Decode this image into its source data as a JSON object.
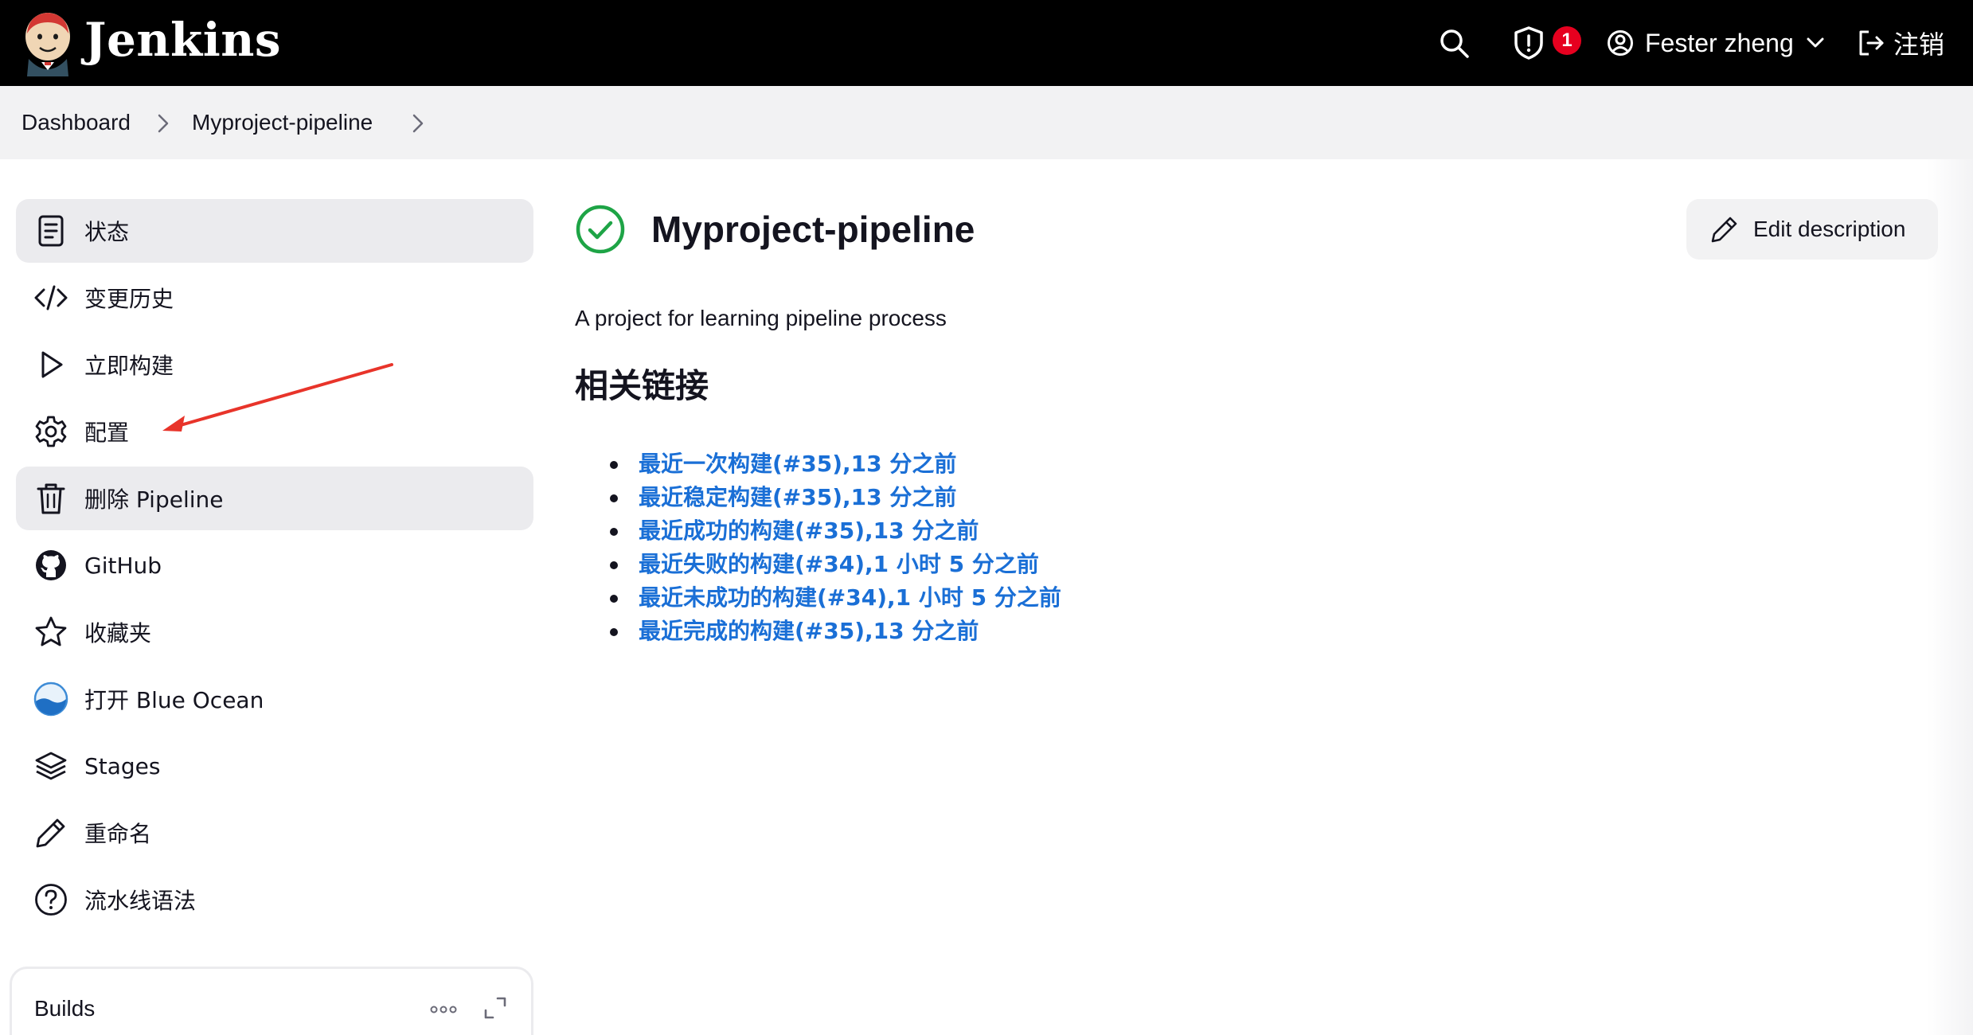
{
  "header": {
    "brand": "Jenkins",
    "security_count": "1",
    "user_name": "Fester zheng",
    "logout_label": "注销",
    "icons": [
      "jenkins-logo",
      "search-icon",
      "shield-icon",
      "user-icon",
      "chevron-down-icon",
      "logout-icon"
    ],
    "colors": {
      "bar": "#000000",
      "badge": "#e6001f"
    }
  },
  "breadcrumb": {
    "items": [
      "Dashboard",
      "Myproject-pipeline"
    ]
  },
  "sidebar": {
    "items": [
      {
        "label": "状态",
        "icon": "document-icon",
        "active": true
      },
      {
        "label": "变更历史",
        "icon": "code-icon"
      },
      {
        "label": "立即构建",
        "icon": "play-icon"
      },
      {
        "label": "配置",
        "icon": "gear-icon"
      },
      {
        "label": "删除 Pipeline",
        "icon": "trash-icon",
        "hovered": true
      },
      {
        "label": "GitHub",
        "icon": "github-icon"
      },
      {
        "label": "收藏夹",
        "icon": "star-icon"
      },
      {
        "label": "打开 Blue Ocean",
        "icon": "blue-ocean-icon"
      },
      {
        "label": "Stages",
        "icon": "layers-icon"
      },
      {
        "label": "重命名",
        "icon": "pencil-icon"
      },
      {
        "label": "流水线语法",
        "icon": "help-icon"
      }
    ],
    "builds_title": "Builds"
  },
  "main": {
    "title": "Myproject-pipeline",
    "status": "success",
    "edit_description_label": "Edit description",
    "description": "A project for learning pipeline process",
    "links_heading": "相关链接",
    "links": [
      "最近一次构建(#35),13 分之前",
      "最近稳定构建(#35),13 分之前",
      "最近成功的构建(#35),13 分之前",
      "最近失败的构建(#34),1 小时 5 分之前",
      "最近未成功的构建(#34),1 小时 5 分之前",
      "最近完成的构建(#35),13 分之前"
    ],
    "colors": {
      "link": "#1a6fd6",
      "success": "#1ea446",
      "annotation_arrow": "#e8342a"
    }
  }
}
